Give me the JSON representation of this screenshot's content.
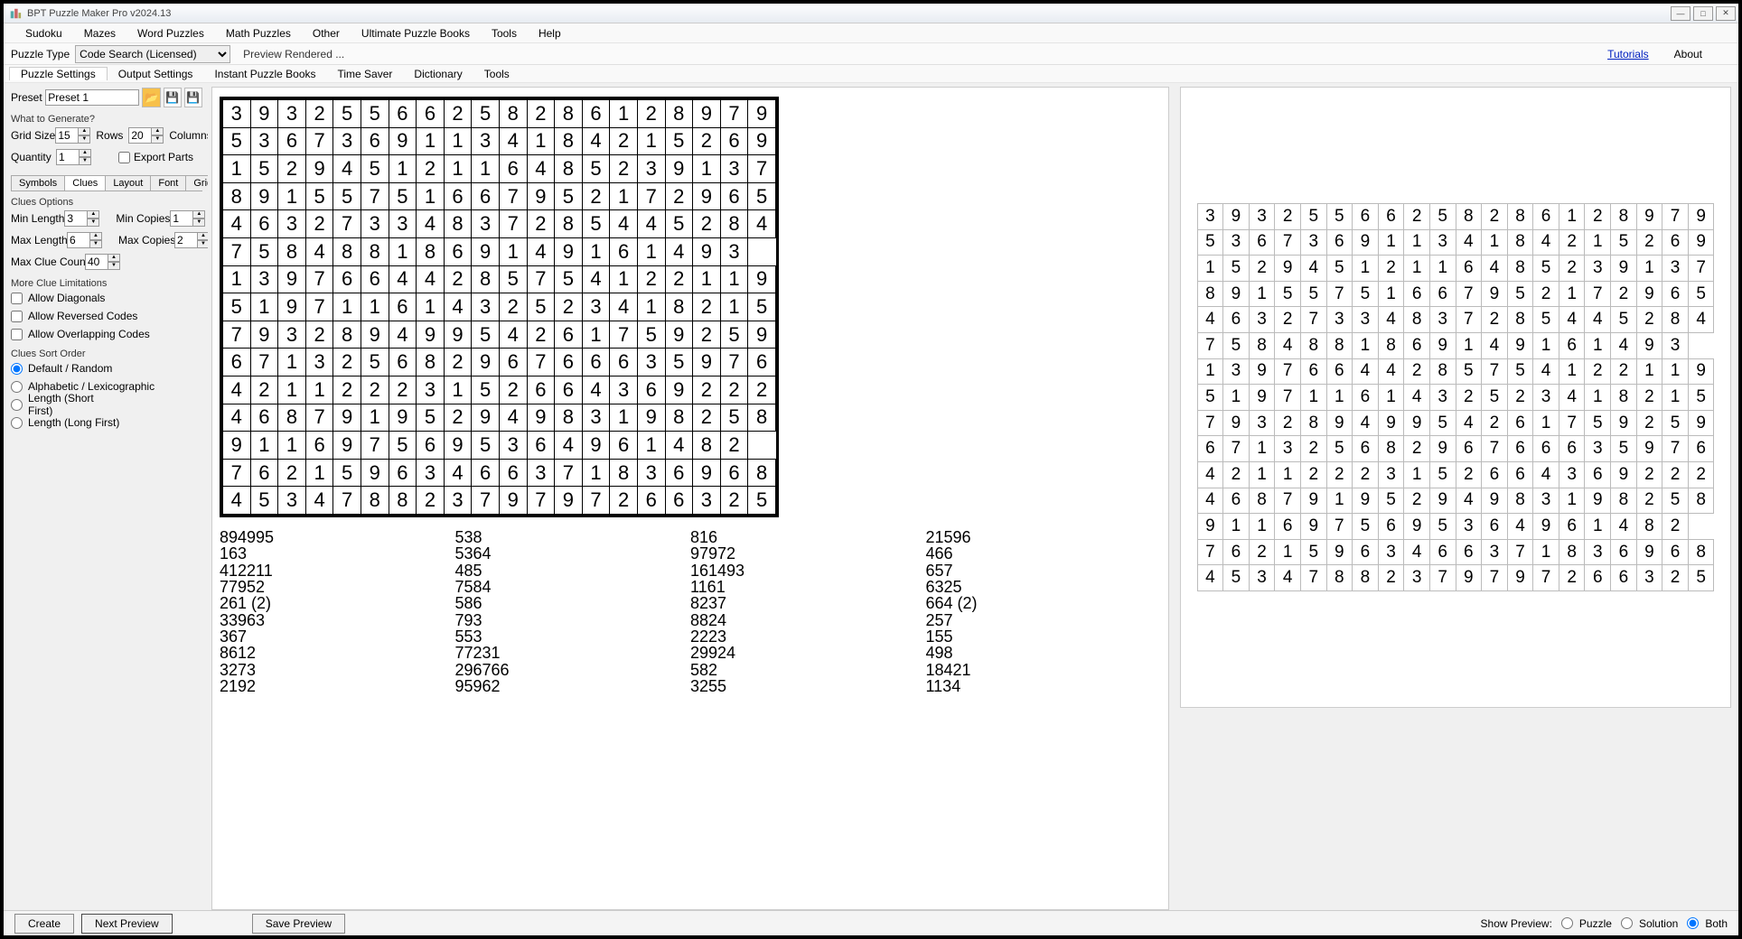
{
  "title": "BPT Puzzle Maker Pro v2024.13",
  "menubar": [
    "Sudoku",
    "Mazes",
    "Word Puzzles",
    "Math Puzzles",
    "Other",
    "Ultimate Puzzle Books",
    "Tools",
    "Help"
  ],
  "toolbar": {
    "puzzle_type_label": "Puzzle Type",
    "puzzle_type_value": "Code Search (Licensed)",
    "status": "Preview Rendered ...",
    "tutorials": "Tutorials",
    "about": "About"
  },
  "tabs": [
    "Puzzle Settings",
    "Output Settings",
    "Instant Puzzle Books",
    "Time Saver",
    "Dictionary",
    "Tools"
  ],
  "left": {
    "preset_label": "Preset",
    "preset_value": "Preset 1",
    "what_to_generate": "What to Generate?",
    "grid_size_label": "Grid Size",
    "grid_rows": "15",
    "rows_label": "Rows",
    "grid_cols": "20",
    "cols_label": "Columns",
    "quantity_label": "Quantity",
    "quantity_value": "1",
    "export_parts_label": "Export Parts",
    "tabs2": [
      "Symbols",
      "Clues",
      "Layout",
      "Font",
      "Grid Styling"
    ],
    "clues_options": "Clues Options",
    "min_len_label": "Min Length",
    "min_len": "3",
    "min_copies_label": "Min Copies",
    "min_copies": "1",
    "max_len_label": "Max Length",
    "max_len": "6",
    "max_copies_label": "Max Copies",
    "max_copies": "2",
    "max_clue_label": "Max Clue Count",
    "max_clue": "40",
    "more_limits": "More Clue Limitations",
    "allow_diag": "Allow Diagonals",
    "allow_rev": "Allow Reversed Codes",
    "allow_over": "Allow Overlapping Codes",
    "sort_order": "Clues Sort Order",
    "r1": "Default / Random",
    "r2": "Alphabetic / Lexicographic",
    "r3": "Length (Short First)",
    "r4": "Length (Long First)"
  },
  "grid_rows": [
    [
      3,
      9,
      3,
      2,
      5,
      5,
      6,
      6,
      2,
      5,
      8,
      2,
      8,
      6,
      1,
      2,
      8,
      9,
      7,
      9
    ],
    [
      5,
      3,
      6,
      7,
      3,
      6,
      9,
      1,
      1,
      3,
      4,
      1,
      8,
      4,
      2,
      1,
      5,
      2,
      6,
      9
    ],
    [
      1,
      5,
      2,
      9,
      4,
      5,
      1,
      2,
      1,
      1,
      6,
      4,
      8,
      5,
      2,
      3,
      9,
      1,
      3,
      7
    ],
    [
      8,
      9,
      1,
      5,
      5,
      7,
      5,
      1,
      6,
      6,
      7,
      9,
      5,
      2,
      1,
      7,
      2,
      9,
      6,
      5
    ],
    [
      4,
      6,
      3,
      2,
      7,
      3,
      3,
      4,
      8,
      3,
      7,
      2,
      8,
      5,
      4,
      4,
      5,
      2,
      8,
      4
    ],
    [
      7,
      5,
      8,
      4,
      8,
      8,
      1,
      8,
      6,
      9,
      1,
      4,
      9,
      1,
      6,
      1,
      4,
      9,
      3
    ],
    [
      1,
      3,
      9,
      7,
      6,
      6,
      4,
      4,
      2,
      8,
      5,
      7,
      5,
      4,
      1,
      2,
      2,
      1,
      1,
      9
    ],
    [
      5,
      1,
      9,
      7,
      1,
      1,
      6,
      1,
      4,
      3,
      2,
      5,
      2,
      3,
      4,
      1,
      8,
      2,
      1,
      5
    ],
    [
      7,
      9,
      3,
      2,
      8,
      9,
      4,
      9,
      9,
      5,
      4,
      2,
      6,
      1,
      7,
      5,
      9,
      2,
      5,
      9
    ],
    [
      6,
      7,
      1,
      3,
      2,
      5,
      6,
      8,
      2,
      9,
      6,
      7,
      6,
      6,
      6,
      3,
      5,
      9,
      7,
      6
    ],
    [
      4,
      2,
      1,
      1,
      2,
      2,
      2,
      3,
      1,
      5,
      2,
      6,
      6,
      4,
      3,
      6,
      9,
      2,
      2,
      2
    ],
    [
      4,
      6,
      8,
      7,
      9,
      1,
      9,
      5,
      2,
      9,
      4,
      9,
      8,
      3,
      1,
      9,
      8,
      2,
      5,
      8
    ],
    [
      9,
      1,
      1,
      6,
      9,
      7,
      5,
      6,
      9,
      5,
      3,
      6,
      4,
      9,
      6,
      1,
      4,
      8,
      2
    ],
    [
      7,
      6,
      2,
      1,
      5,
      9,
      6,
      3,
      4,
      6,
      6,
      3,
      7,
      1,
      8,
      3,
      6,
      9,
      6,
      8
    ],
    [
      4,
      5,
      3,
      4,
      7,
      8,
      8,
      2,
      3,
      7,
      9,
      7,
      9,
      7,
      2,
      6,
      6,
      3,
      2,
      5
    ]
  ],
  "clues": [
    [
      "894995",
      "163",
      "412211",
      "77952",
      "261  (2)",
      "33963",
      "367",
      "8612",
      "3273",
      "2192"
    ],
    [
      "538",
      "5364",
      "485",
      "7584",
      "586",
      "793",
      "553",
      "77231",
      "296766",
      "95962"
    ],
    [
      "816",
      "97972",
      "161493",
      "1161",
      "8237",
      "8824",
      "2223",
      "29924",
      "582",
      "3255"
    ],
    [
      "21596",
      "466",
      "657",
      "6325",
      "664  (2)",
      "257",
      "155",
      "498",
      "18421",
      "1134"
    ]
  ],
  "footer": {
    "create": "Create",
    "next_preview": "Next Preview",
    "save_preview": "Save Preview",
    "show_preview": "Show Preview:",
    "puzzle": "Puzzle",
    "solution": "Solution",
    "both": "Both"
  }
}
